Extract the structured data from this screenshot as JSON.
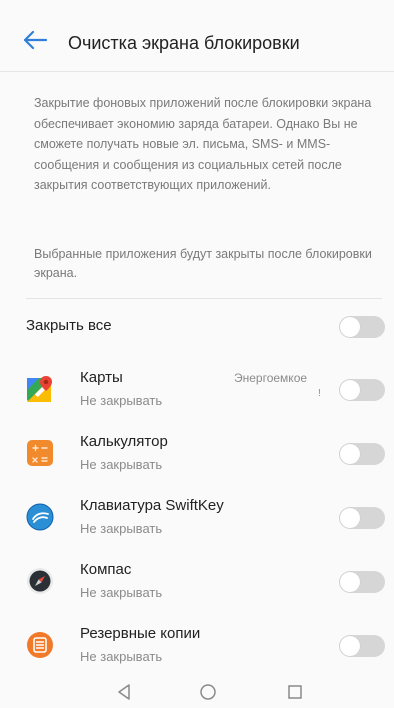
{
  "header": {
    "title": "Очистка экрана блокировки"
  },
  "description": {
    "paragraph1": "Закрытие фоновых приложений после блокировки экрана обеспечивает экономию заряда батареи. Однако Вы не сможете получать новые эл. письма, SMS- и MMS-сообщения и сообщения из социальных сетей после закрытия соответствующих приложений.",
    "paragraph2": "Выбранные приложения будут закрыты после блокировки экрана."
  },
  "close_all": {
    "label": "Закрыть все",
    "enabled": false
  },
  "apps": [
    {
      "name": "Карты",
      "status": "Не закрывать",
      "badge": "Энергоемкое",
      "badge_mark": "!",
      "icon": "maps-icon",
      "enabled": false
    },
    {
      "name": "Калькулятор",
      "status": "Не закрывать",
      "icon": "calculator-icon",
      "enabled": false
    },
    {
      "name": "Клавиатура SwiftKey",
      "status": "Не закрывать",
      "icon": "swiftkey-icon",
      "enabled": false
    },
    {
      "name": "Компас",
      "status": "Не закрывать",
      "icon": "compass-icon",
      "enabled": false
    },
    {
      "name": "Резервные копии",
      "status": "Не закрывать",
      "icon": "backup-icon",
      "enabled": false
    }
  ],
  "colors": {
    "toggle_off": "#d6d6d6",
    "accent": "#2f7fd8",
    "calculator": "#f08a2c",
    "swiftkey": "#2b8fd6",
    "backup": "#f07a2a"
  },
  "navbar": {
    "icons": [
      "back-triangle-icon",
      "home-circle-icon",
      "recents-square-icon"
    ]
  }
}
